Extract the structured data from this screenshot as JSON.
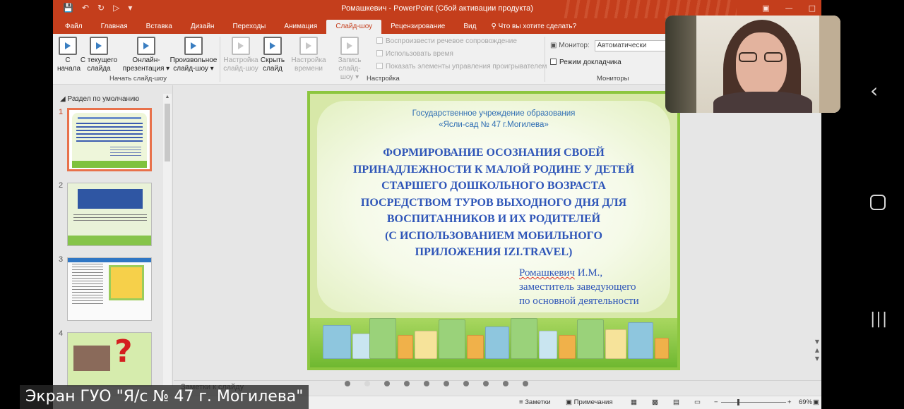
{
  "window": {
    "title": "Ромашкевич - PowerPoint (Сбой активации продукта)"
  },
  "tabs": [
    "Файл",
    "Главная",
    "Вставка",
    "Дизайн",
    "Переходы",
    "Анимация",
    "Слайд-шоу",
    "Рецензирование",
    "Вид"
  ],
  "active_tab": "Слайд-шоу",
  "tell_me": "Что вы хотите сделать?",
  "ribbon": {
    "start_group": {
      "label": "Начать слайд-шоу",
      "buttons": [
        {
          "line1": "С",
          "line2": "начала"
        },
        {
          "line1": "С текущего",
          "line2": "слайда"
        },
        {
          "line1": "Онлайн-",
          "line2": "презентация"
        },
        {
          "line1": "Произвольное",
          "line2": "слайд-шоу"
        }
      ]
    },
    "setup_group": {
      "label": "Настройка",
      "buttons": [
        {
          "line1": "Настройка",
          "line2": "слайд-шоу"
        },
        {
          "line1": "Скрыть",
          "line2": "слайд"
        },
        {
          "line1": "Настройка",
          "line2": "времени"
        },
        {
          "line1": "Запись слайд-",
          "line2": "шоу"
        }
      ],
      "checkboxes": [
        "Воспроизвести речевое сопровождение",
        "Использовать время",
        "Показать элементы управления проигрывателем"
      ]
    },
    "monitors_group": {
      "label": "Мониторы",
      "monitor_label": "Монитор:",
      "monitor_value": "Автоматически",
      "presenter_view": "Режим докладчика"
    }
  },
  "thumbnails": {
    "section": "Раздел по умолчанию",
    "numbers": [
      "1",
      "2",
      "3",
      "4"
    ]
  },
  "slide": {
    "org_line1": "Государственное учреждение образования",
    "org_line2": "«Ясли-сад № 47 г.Могилева»",
    "title_lines": [
      "ФОРМИРОВАНИЕ ОСОЗНАНИЯ СВОЕЙ",
      "ПРИНАДЛЕЖНОСТИ К МАЛОЙ РОДИНЕ У ДЕТЕЙ",
      "СТАРШЕГО ДОШКОЛЬНОГО ВОЗРАСТА",
      "ПОСРЕДСТВОМ ТУРОВ ВЫХОДНОГО ДНЯ ДЛЯ",
      "ВОСПИТАННИКОВ И ИХ РОДИТЕЛЕЙ",
      "(С ИСПОЛЬЗОВАНИЕМ МОБИЛЬНОГО",
      "ПРИЛОЖЕНИЯ IZI.TRAVEL)"
    ],
    "author_name": "Ромашкевич",
    "author_initials": " И.М.,",
    "author_line2": "заместитель заведующего",
    "author_line3": "по основной деятельности"
  },
  "notes_label": "Заметки к слайду",
  "status": {
    "notes": "Заметки",
    "comments": "Примечания",
    "zoom": "69%"
  },
  "caption": "Экран ГУО \"Я/с № 47 г. Могилева\"",
  "colors": {
    "accent": "#c43e1c",
    "slide_title": "#2e55b8",
    "slide_border": "#8cc63f"
  }
}
